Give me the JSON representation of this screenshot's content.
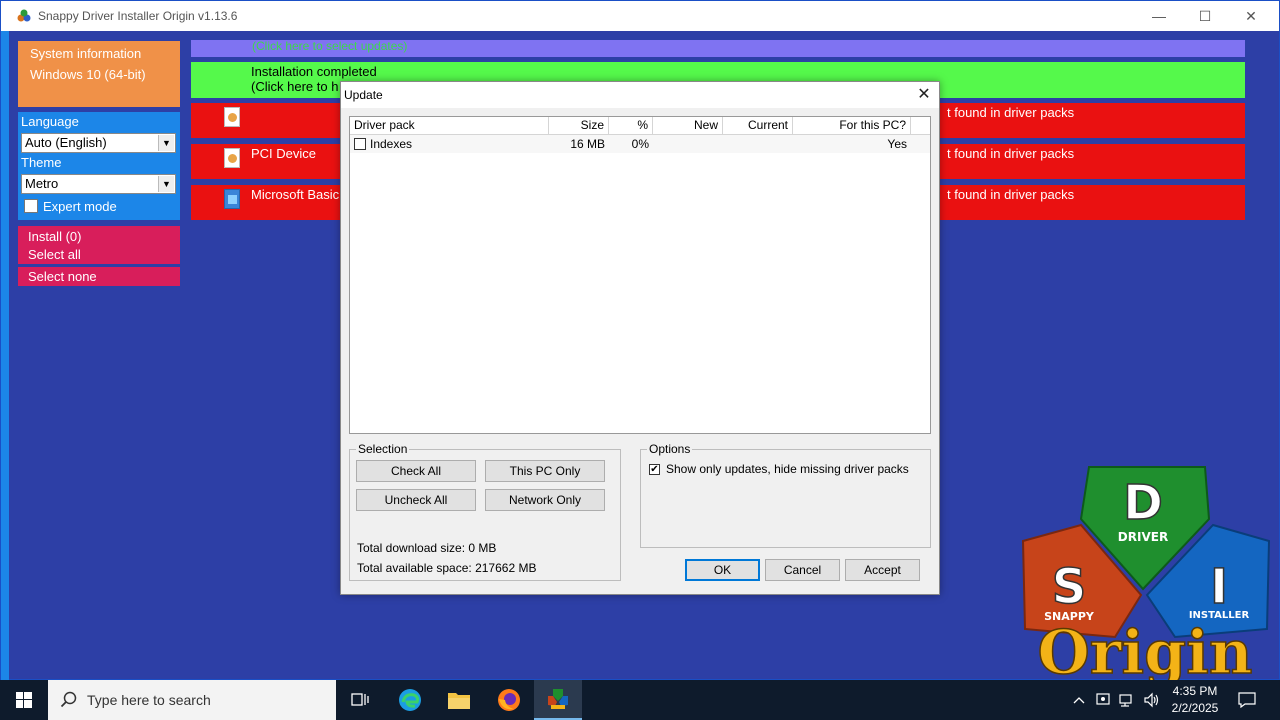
{
  "window": {
    "title": "Snappy Driver Installer Origin v1.13.6",
    "minimize_glyph": "—",
    "maximize_glyph": "☐",
    "close_glyph": "✕"
  },
  "left_panel": {
    "system_information": "System information",
    "os": "Windows 10 (64-bit)",
    "language_label": "Language",
    "language_value": "Auto (English)",
    "theme_label": "Theme",
    "theme_value": "Metro",
    "expert_mode": "Expert mode",
    "install": "Install (0)",
    "select_all": "Select all",
    "select_none": "Select none"
  },
  "rows": {
    "updates": "(Click here to select updates)",
    "installed_line1": "Installation completed",
    "installed_line2": "(Click here to h",
    "devices": [
      {
        "name": "",
        "status": "t found in driver packs",
        "icon": "driver-pack-icon"
      },
      {
        "name": "PCI Device",
        "status": "t found in driver packs",
        "icon": "driver-pack-icon"
      },
      {
        "name": "Microsoft Basic",
        "status": "t found in driver packs",
        "icon": "display-adapter-icon"
      }
    ]
  },
  "dialog": {
    "title": "Update",
    "close_glyph": "✕",
    "columns": [
      "Driver pack",
      "Size",
      "%",
      "New",
      "Current",
      "For this PC?"
    ],
    "rows": [
      {
        "name": "Indexes",
        "size": "16 MB",
        "percent": "0%",
        "new": "",
        "current": "",
        "for_pc": "Yes",
        "checked": false
      }
    ],
    "selection_label": "Selection",
    "check_all": "Check All",
    "this_pc_only": "This PC Only",
    "uncheck_all": "Uncheck All",
    "network_only": "Network Only",
    "total_download": "Total download size: 0 MB",
    "total_space": "Total available space: 217662 MB",
    "options_label": "Options",
    "show_only_updates": "Show only updates, hide missing driver packs",
    "show_only_updates_checked": true,
    "ok": "OK",
    "cancel": "Cancel",
    "accept": "Accept"
  },
  "logo": {
    "d": "D",
    "driver": "DRIVER",
    "s": "S",
    "snappy": "SNAPPY",
    "i": "I",
    "installer": "INSTALLER",
    "origin": "Origin",
    "colors": {
      "green": "#1f8f2e",
      "orange": "#c7441a",
      "blue": "#1466c1",
      "gold": "#f3b317"
    }
  },
  "taskbar": {
    "search_placeholder": "Type here to search",
    "time": "4:35 PM",
    "date": "2/2/2025"
  },
  "colors": {
    "desktop_bg": "#2d3fa6",
    "sysinfo": "#f09148",
    "panel_blue": "#1c86e8",
    "install_pink": "#d81e5b",
    "row_updates": "#7f73f2",
    "row_installed": "#55f94b",
    "row_missing": "#ea1111"
  }
}
